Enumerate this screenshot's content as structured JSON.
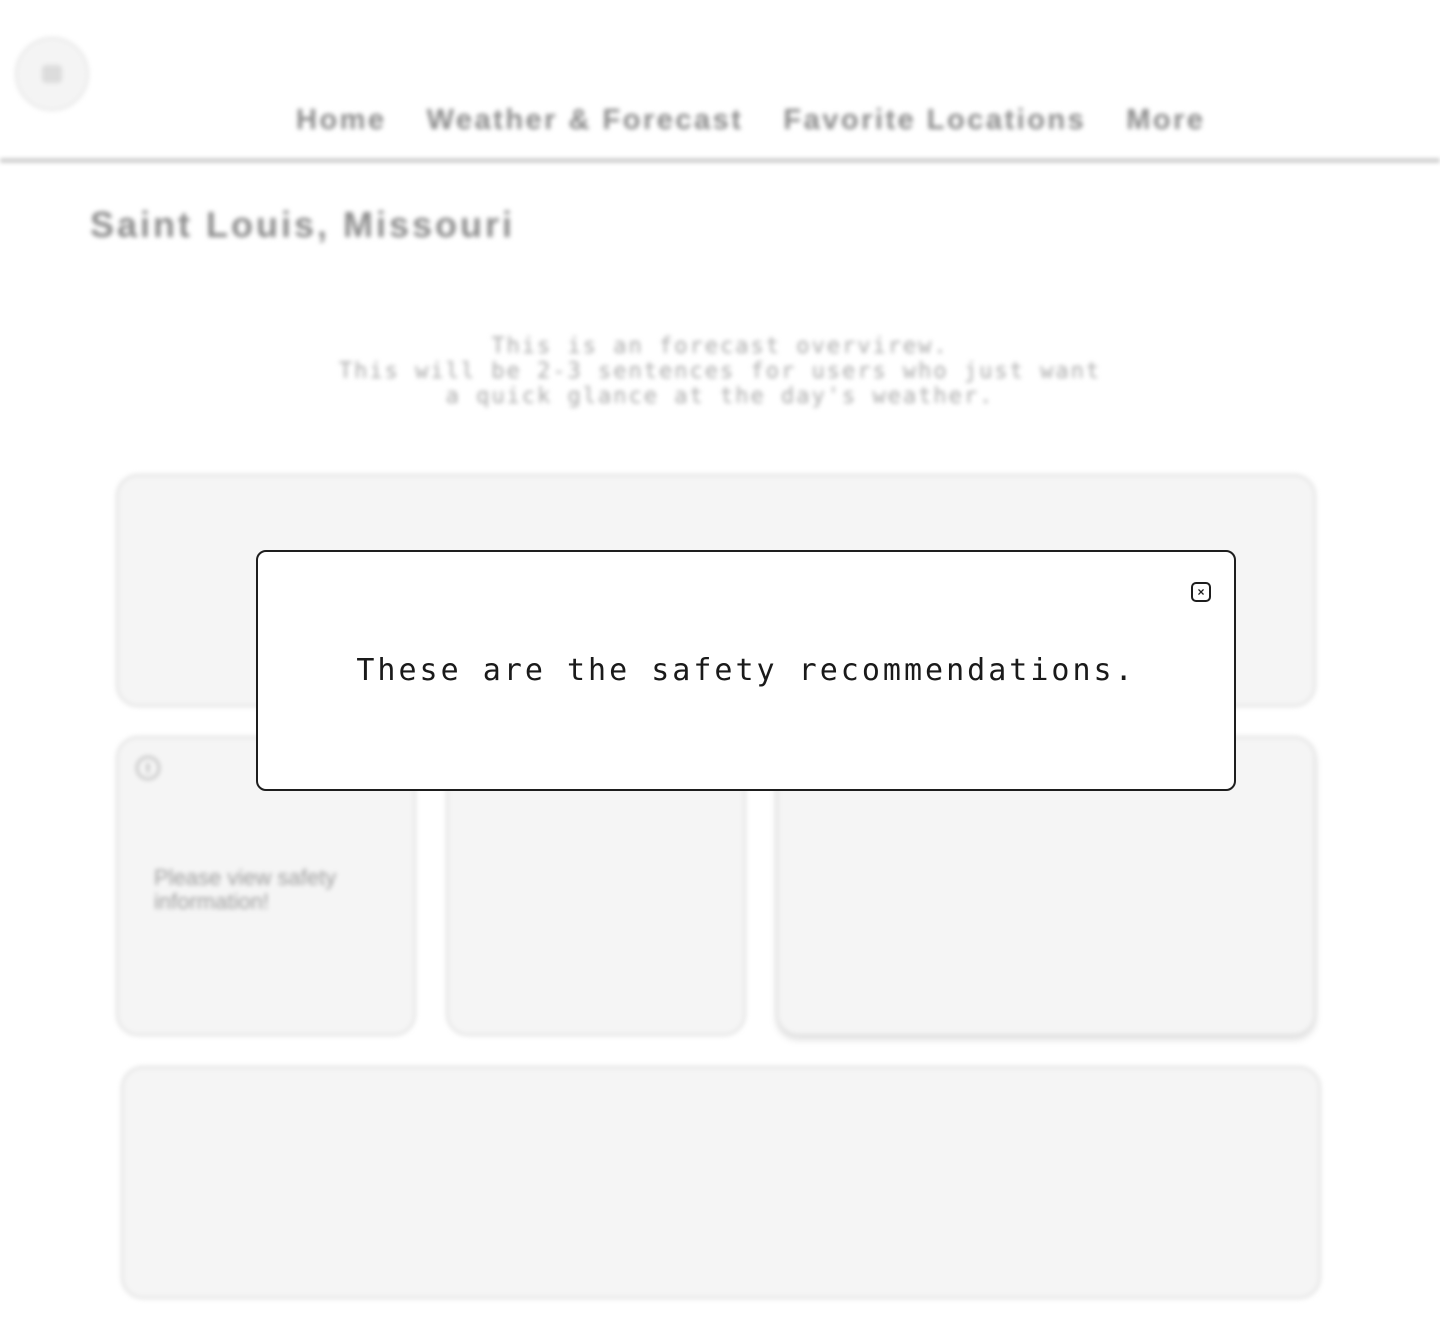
{
  "header": {
    "logo_icon": "logo-icon",
    "nav": {
      "home": "Home",
      "weather": "Weather & Forecast",
      "favorites": "Favorite Locations",
      "more": "More"
    }
  },
  "main": {
    "title": "Saint Louis, Missouri",
    "overview": {
      "line1": "This is an forecast overvirew.",
      "line2": "This will be 2-3 sentences for users who just want",
      "line3": "a quick glance at the day's weather."
    },
    "safety_card": {
      "icon": "alert-icon",
      "text": "Please view safety information!"
    }
  },
  "modal": {
    "message": "These are the safety recommendations.",
    "close_icon": "close-icon",
    "close_glyph": "×"
  },
  "colors": {
    "modal_border": "#1e1e1e",
    "card_background": "#f5f5f5",
    "muted_text": "#8a8a8a"
  }
}
